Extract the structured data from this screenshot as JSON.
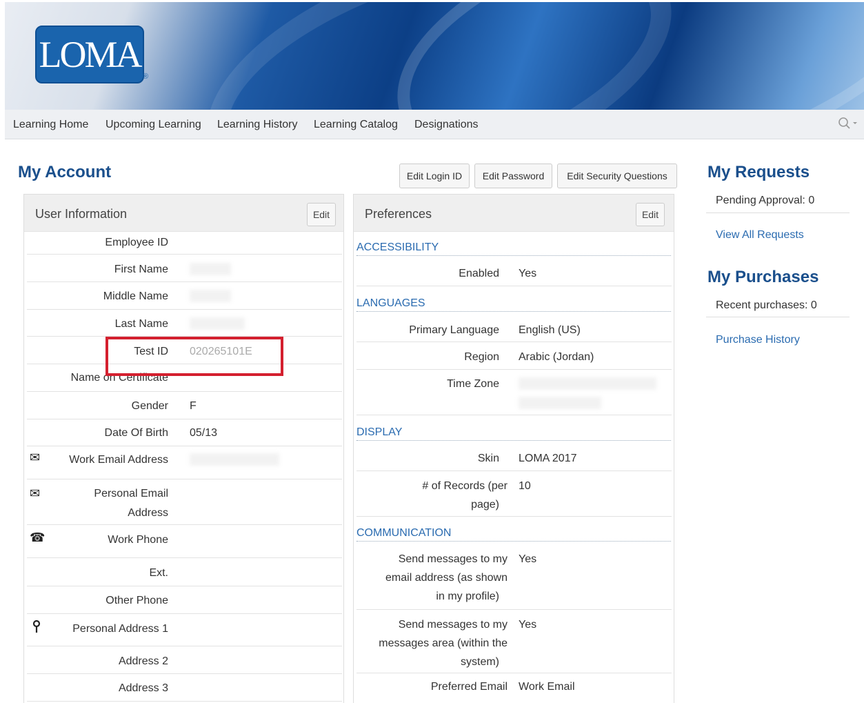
{
  "brand": {
    "logo_text": "LOMA",
    "reg_mark": "®"
  },
  "nav": {
    "items": [
      "Learning Home",
      "Upcoming Learning",
      "Learning History",
      "Learning Catalog",
      "Designations"
    ],
    "search_icon": "⚲",
    "dropdown_icon": "▾"
  },
  "page_title": "My Account",
  "actions": {
    "edit_login": "Edit Login ID",
    "edit_password": "Edit Password",
    "edit_security": "Edit Security Questions"
  },
  "user_info": {
    "title": "User Information",
    "edit": "Edit",
    "fields": {
      "employee_id": "Employee ID",
      "first_name": "First Name",
      "middle_name": "Middle Name",
      "last_name": "Last Name",
      "test_id": "Test ID",
      "test_id_value": "020265101E",
      "name_on_certificate": "Name on Certificate",
      "gender": "Gender",
      "gender_value": "F",
      "dob": "Date Of Birth",
      "dob_value": "05/13",
      "work_email": "Work Email Address",
      "personal_email_1": "Personal Email",
      "personal_email_2": "Address",
      "work_phone": "Work Phone",
      "ext": "Ext.",
      "other_phone": "Other Phone",
      "personal_address_1": "Personal Address 1",
      "address_2": "Address 2",
      "address_3": "Address 3"
    },
    "icons": {
      "envelope": "✉",
      "phone": "☎",
      "pin": "⚲"
    }
  },
  "preferences": {
    "title": "Preferences",
    "edit": "Edit",
    "accessibility": {
      "label": "ACCESSIBILITY",
      "enabled_label": "Enabled",
      "enabled_value": "Yes"
    },
    "languages": {
      "label": "LANGUAGES",
      "primary_label": "Primary Language",
      "primary_value": "English (US)",
      "region_label": "Region",
      "region_value": "Arabic (Jordan)",
      "timezone_label": "Time Zone"
    },
    "display": {
      "label": "DISPLAY",
      "skin_label": "Skin",
      "skin_value": "LOMA 2017",
      "records_label_1": "# of Records (per",
      "records_label_2": "page)",
      "records_value": "10"
    },
    "communication": {
      "label": "COMMUNICATION",
      "email_label_1": "Send messages to my",
      "email_label_2": "email address (as shown",
      "email_label_3": "in my profile)",
      "email_value": "Yes",
      "area_label_1": "Send messages to my",
      "area_label_2": "messages area (within the",
      "area_label_3": "system)",
      "area_value": "Yes",
      "pref_email_label": "Preferred Email",
      "pref_email_value": "Work Email"
    }
  },
  "requests": {
    "title": "My Requests",
    "pending": "Pending Approval: 0",
    "view_all": "View All Requests"
  },
  "purchases": {
    "title": "My Purchases",
    "recent": "Recent purchases: 0",
    "history": "Purchase History"
  },
  "colors": {
    "accent": "#1a4f8c",
    "link": "#2a6bb0",
    "highlight": "#d4202f"
  }
}
